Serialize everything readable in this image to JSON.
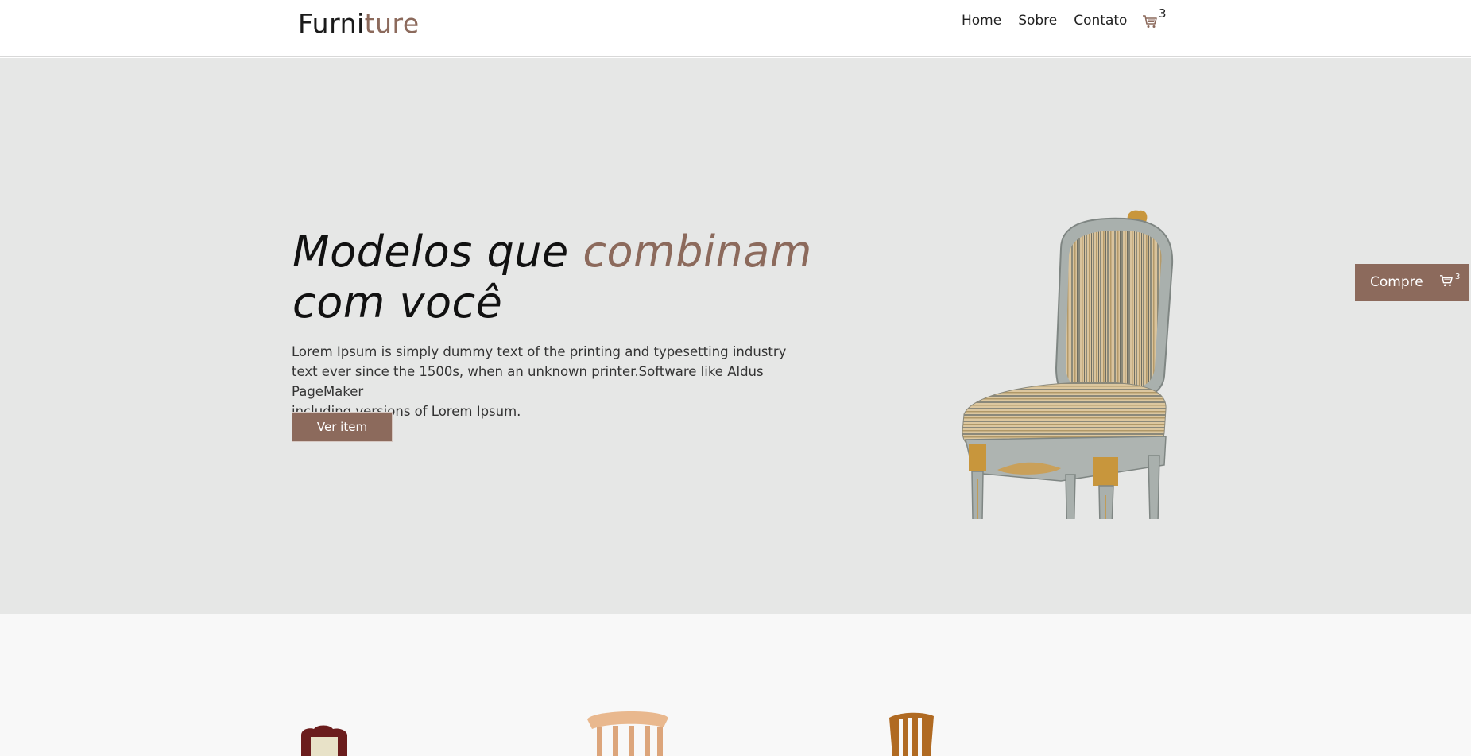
{
  "header": {
    "logo_part1": "Furni",
    "logo_part2": "ture",
    "nav": [
      "Home",
      "Sobre",
      "Contato"
    ],
    "cart_count": "3"
  },
  "hero": {
    "title_part1": "Modelos que ",
    "title_accent": "combinam",
    "title_part2": "com você",
    "description_lines": [
      "Lorem Ipsum is simply dummy text of the printing and typesetting industry",
      "text ever since the 1500s, when an unknown printer.Software like Aldus PageMaker",
      "including versions of Lorem Ipsum."
    ],
    "button_label": "Ver item"
  },
  "side_buy": {
    "label": "Compre",
    "cart_count": "3"
  },
  "colors": {
    "accent": "#8c6a5c",
    "hero_bg": "#e6e7e6",
    "products_bg": "#f8f8f8"
  },
  "icons": [
    "cart-icon",
    "chair-image",
    "chair-thumb"
  ]
}
